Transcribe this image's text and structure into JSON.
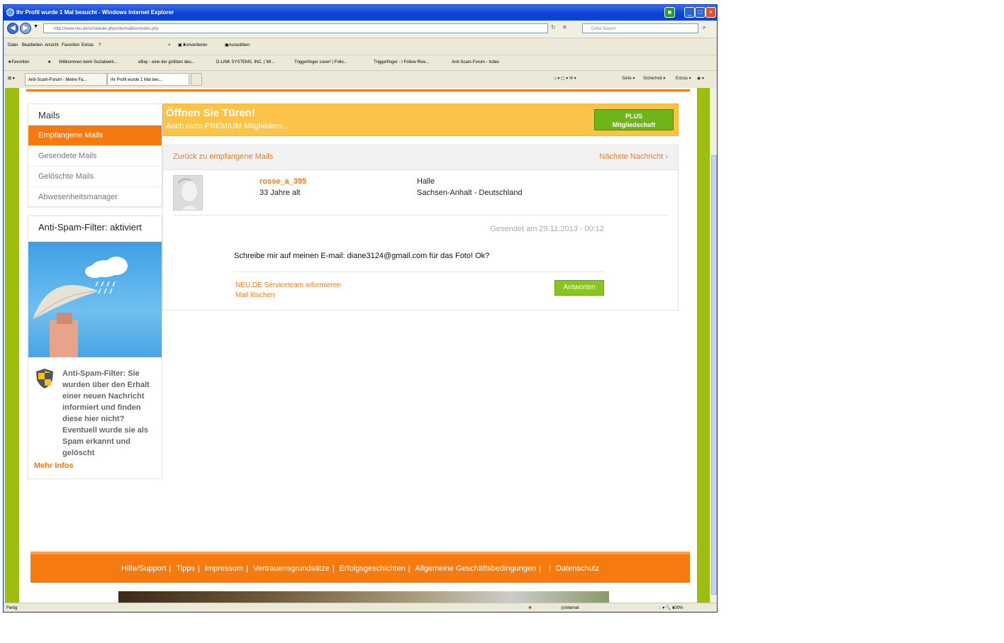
{
  "window": {
    "title": "Ihr Profil wurde 1 Mal besucht - Windows Internet Explorer"
  },
  "browser": {
    "url": "http://www.neu.de/scheduler.php/site/mailbox/index.php",
    "search_placeholder": "Delta Search",
    "menu": [
      "Datei",
      "Bearbeiten",
      "Ansicht",
      "Favoriten",
      "Extras",
      "?"
    ],
    "toolbar": {
      "convert": "Konvertieren",
      "select": "Auswählen"
    },
    "favorites_label": "Favoriten",
    "favorites": [
      "Willkommen beim Sozialwerk...",
      "eBay - eine der größten deu...",
      "D-LINK SYSTEMS, INC. | WI...",
      "Triggerfinger cover! | Follo...",
      "Triggerfinger - I Follow Rive...",
      "Anti-Scam-Forum - Index"
    ],
    "tabs": [
      "Anti-Scam-Forum - Meine Fa...",
      "Ihr Profil wurde 1 Mal bes..."
    ],
    "tools": [
      "Seite",
      "Sicherheit",
      "Extras"
    ],
    "status_left": "Fertig",
    "status_zone": "Internet",
    "zoom": "100%"
  },
  "sidebar": {
    "mails_header": "Mails",
    "items": [
      {
        "label": "Empfangene Mails",
        "active": true
      },
      {
        "label": "Gesendete Mails",
        "active": false
      },
      {
        "label": "Gelöschte Mails",
        "active": false
      },
      {
        "label": "Abwesenheitsmanager",
        "active": false
      }
    ],
    "spam_header": "Anti-Spam-Filter: aktiviert",
    "spam_text": "Anti-Spam-Filter: Sie wurden über den Erhalt einer neuen Nachricht informiert und finden diese hier nicht? Eventuell wurde sie als Spam erkannt und gelöscht",
    "more_info": "Mehr Infos"
  },
  "promo": {
    "title": "Öffnen Sie Türen!",
    "subtitle": "Auch nicht-PREMIUM Mitgliedern...",
    "button_line1": "PLUS",
    "button_line2": "Mitgliedschaft"
  },
  "message": {
    "back": "Zurück zu empfangene Mails",
    "next": "Nächste Nachricht ›",
    "username": "rosse_a_395",
    "age": "33 Jahre alt",
    "city": "Halle",
    "region": "Sachsen-Anhalt - Deutschland",
    "sent": "Gesendet am 29.11.2013 - 00:12",
    "body": "Schreibe mir auf meinen E-mail: diane3124@gmail.com für das Foto! Ok?",
    "report": "NEU.DE Serviceteam informieren",
    "delete": "Mail löschen",
    "reply": "Antworten"
  },
  "footer": {
    "links": [
      "Hilfe/Support",
      "Tipps",
      "Impressum",
      "Vertrauensgrundsätze",
      "Erfolgsgeschichten",
      "Allgemeine Geschäftsbedingungen",
      "",
      "Datenschutz"
    ]
  },
  "colors": {
    "accent": "#f57a10",
    "page_bg": "#9dbe10",
    "promo": "#fbc348",
    "button_green": "#89c420"
  }
}
